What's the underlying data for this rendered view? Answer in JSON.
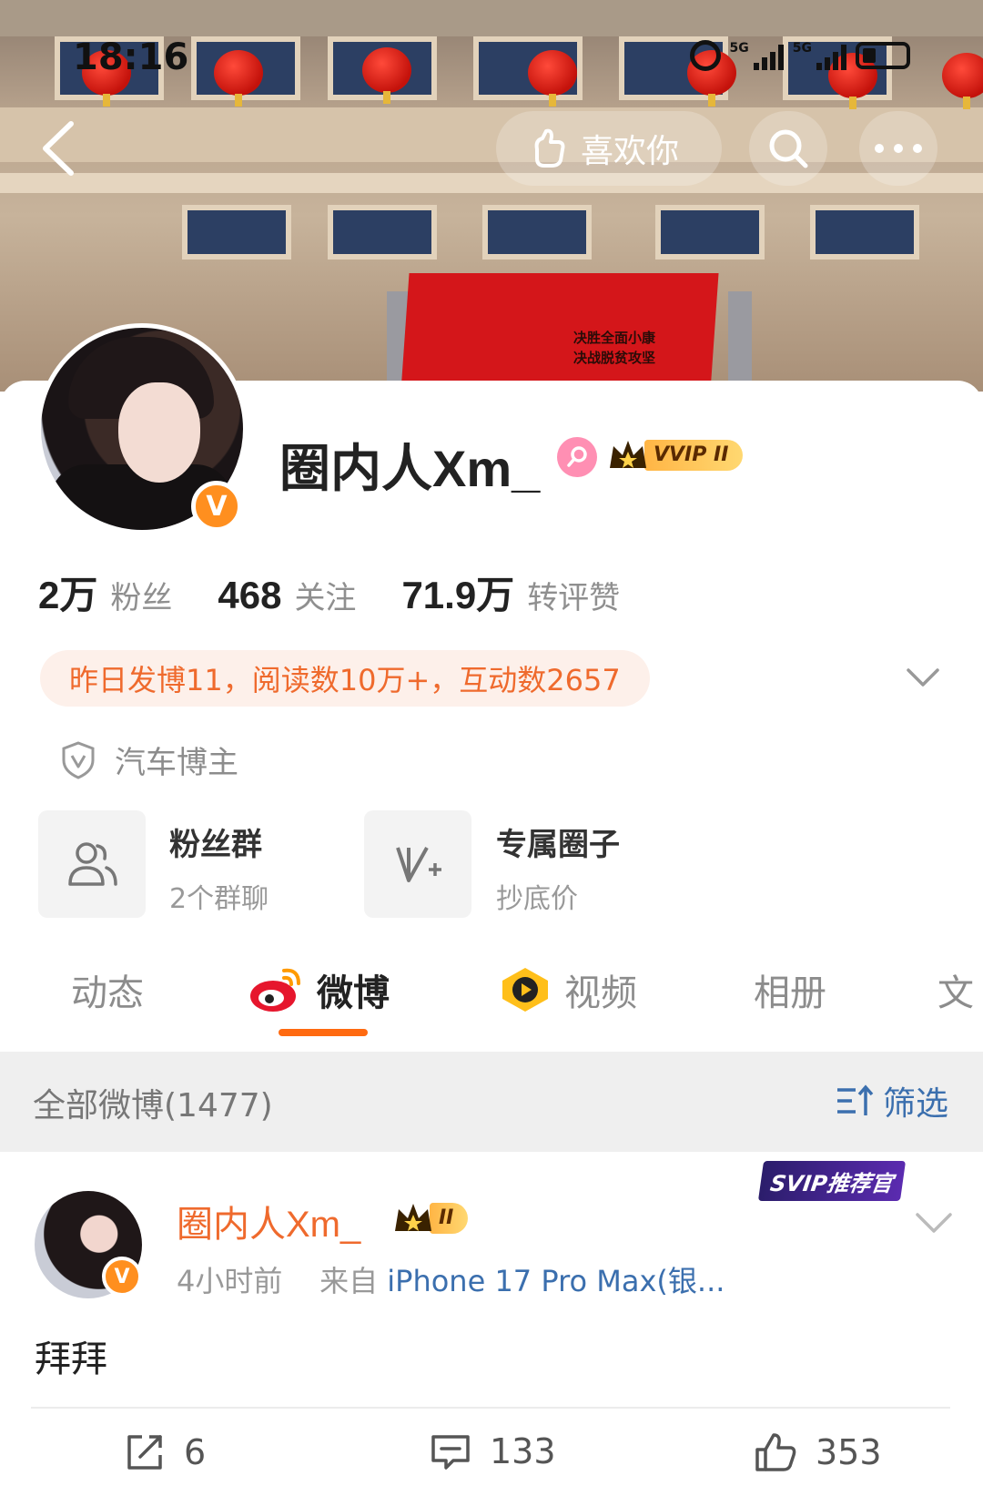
{
  "status_bar": {
    "time": "18:16",
    "network_1": "5G",
    "network_2": "5G"
  },
  "nav": {
    "like_label": "喜欢你"
  },
  "profile": {
    "name": "圈内人Xm_",
    "vip_tag": "VVIP II",
    "stats": [
      {
        "value": "2万",
        "label": "粉丝"
      },
      {
        "value": "468",
        "label": "关注"
      },
      {
        "value": "71.9万",
        "label": "转评赞"
      }
    ],
    "activity": "昨日发博11，阅读数10万+，互动数2657",
    "certification": "汽车博主",
    "tiles": [
      {
        "title": "粉丝群",
        "subtitle": "2个群聊"
      },
      {
        "title": "专属圈子",
        "subtitle": "抄底价"
      }
    ]
  },
  "cover": {
    "banner_text_1": "决胜全面小康",
    "banner_text_2": "决战脱贫攻坚"
  },
  "tabs": [
    "动态",
    "微博",
    "视频",
    "相册",
    "文"
  ],
  "active_tab": "微博",
  "filter": {
    "label": "全部微博(1477)",
    "button": "筛选"
  },
  "post": {
    "author": "圈内人Xm_",
    "vip_tag": "II",
    "time": "4小时前",
    "source_prefix": "来自",
    "source": "iPhone 17 Pro Max(银...",
    "badge": "SVIP推荐官",
    "text": "拜拜",
    "reposts": "6",
    "comments": "133",
    "likes": "353"
  },
  "colors": {
    "accent": "#ff6a10",
    "name_orange": "#ef6a2d",
    "link_blue": "#3b6fae",
    "verified": "#ff8f1f"
  }
}
